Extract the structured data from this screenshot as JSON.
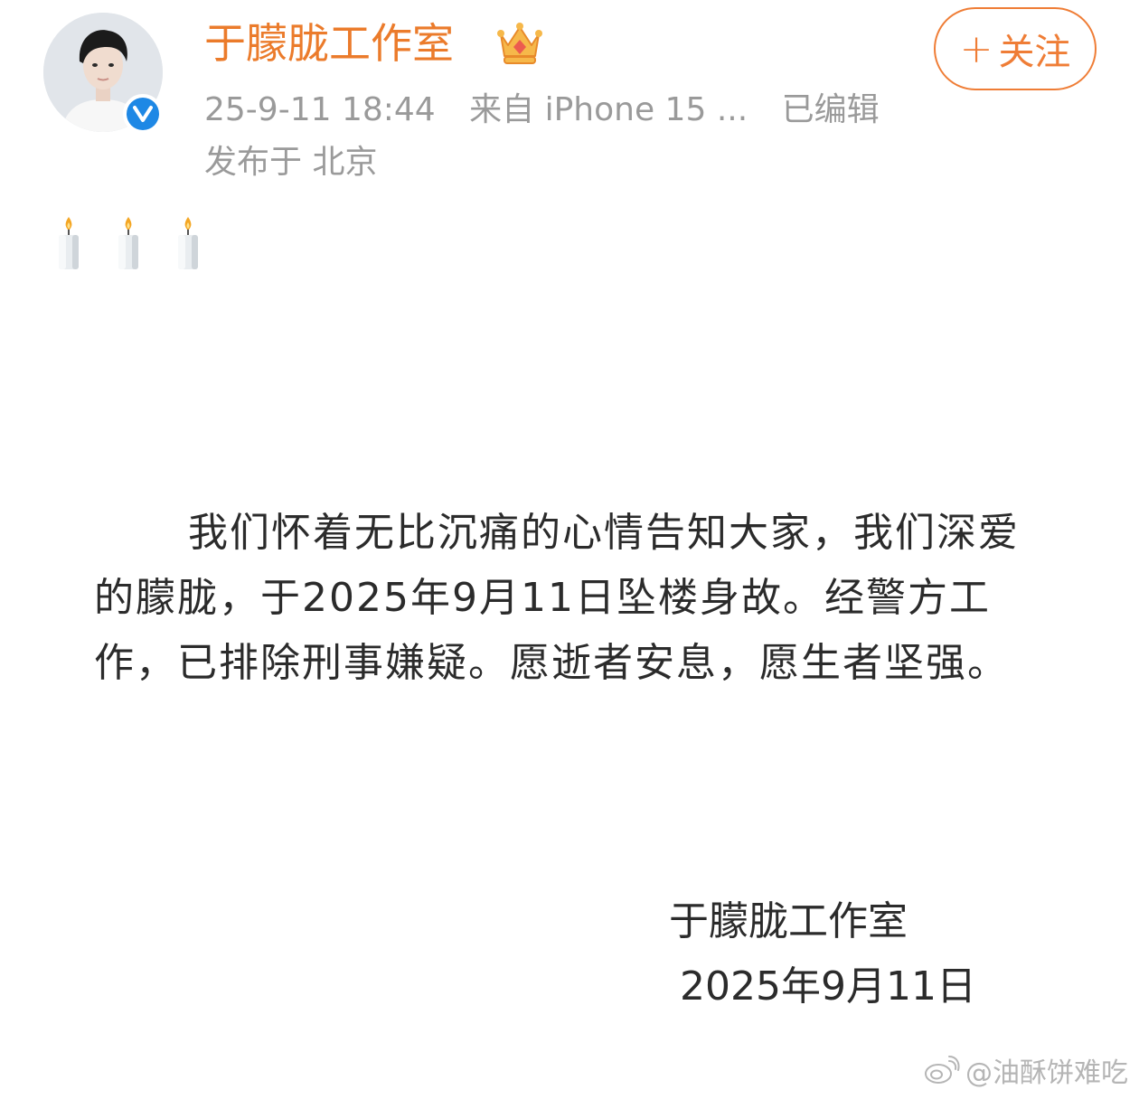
{
  "post": {
    "author_name": "于朦胧工作室",
    "timestamp": "25-9-11 18:44",
    "source": "来自 iPhone 15 ...",
    "edited": "已编辑",
    "location": "发布于 北京",
    "follow_label": "关注",
    "follow_icon": "+",
    "emoji": [
      "candle",
      "candle",
      "candle"
    ],
    "statement": "我们怀着无比沉痛的心情告知大家，我们深爱的朦胧，于2025年9月11日坠楼身故。经警方工作，已排除刑事嫌疑。愿逝者安息，愿生者坚强。",
    "signature_name": "于朦胧工作室",
    "signature_date": "2025年9月11日",
    "watermark": "@油酥饼难吃"
  },
  "colors": {
    "accent": "#eb7b2b",
    "meta_text": "#9a9a9a",
    "body_text": "#2b2b2b",
    "verified_blue": "#1e88e5"
  }
}
